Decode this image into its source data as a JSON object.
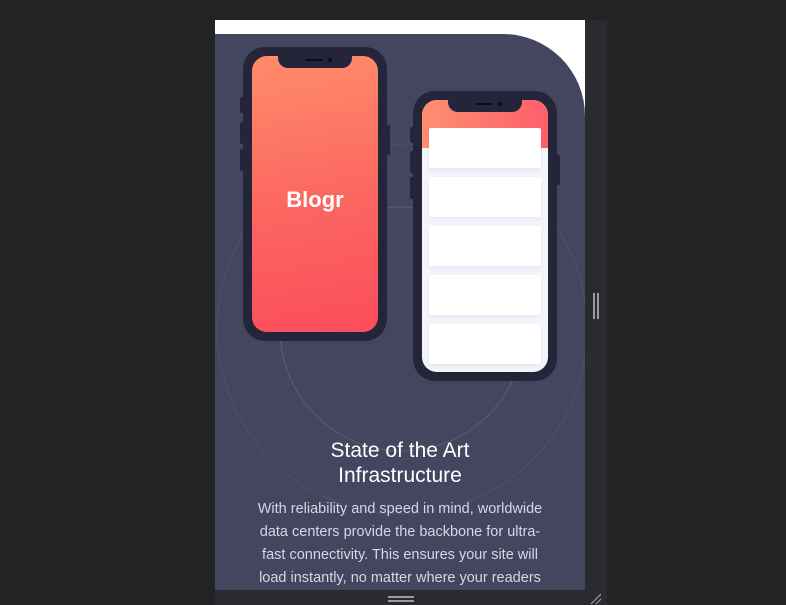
{
  "section": {
    "title_line1": "State of the Art",
    "title_line2": "Infrastructure",
    "body": "With reliability and speed in mind, worldwide data centers provide the backbone for ultra-fast connectivity. This ensures your site will load instantly, no matter where your readers are, keeping"
  },
  "phone_left": {
    "logo": "Blogr"
  },
  "phone_right": {
    "cards": 5
  },
  "colors": {
    "page_background": "#232325",
    "section_background": "#44455f",
    "gradient_start": "#ff8f70",
    "gradient_end": "#fb4d5d",
    "phone_frame": "#25253a"
  },
  "icons": {
    "vertical_resize": "vertical-resize-handle-icon",
    "horizontal_resize": "horizontal-resize-handle-icon",
    "corner_resize": "corner-resize-icon"
  }
}
